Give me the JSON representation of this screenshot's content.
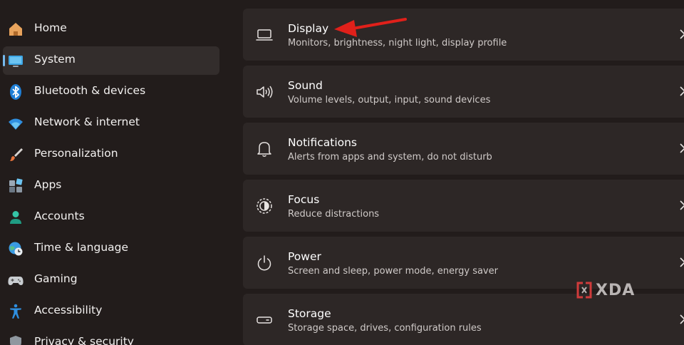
{
  "sidebar": {
    "items": [
      {
        "label": "Home",
        "icon": "home-icon"
      },
      {
        "label": "System",
        "icon": "monitor-icon",
        "active": true
      },
      {
        "label": "Bluetooth & devices",
        "icon": "bluetooth-icon"
      },
      {
        "label": "Network & internet",
        "icon": "wifi-icon"
      },
      {
        "label": "Personalization",
        "icon": "paintbrush-icon"
      },
      {
        "label": "Apps",
        "icon": "apps-icon"
      },
      {
        "label": "Accounts",
        "icon": "person-icon"
      },
      {
        "label": "Time & language",
        "icon": "globe-clock-icon"
      },
      {
        "label": "Gaming",
        "icon": "gamepad-icon"
      },
      {
        "label": "Accessibility",
        "icon": "accessibility-icon"
      },
      {
        "label": "Privacy & security",
        "icon": "shield-icon"
      }
    ]
  },
  "main": {
    "cards": [
      {
        "title": "Display",
        "subtitle": "Monitors, brightness, night light, display profile",
        "icon": "display-icon"
      },
      {
        "title": "Sound",
        "subtitle": "Volume levels, output, input, sound devices",
        "icon": "speaker-icon"
      },
      {
        "title": "Notifications",
        "subtitle": "Alerts from apps and system, do not disturb",
        "icon": "bell-icon"
      },
      {
        "title": "Focus",
        "subtitle": "Reduce distractions",
        "icon": "focus-icon"
      },
      {
        "title": "Power",
        "subtitle": "Screen and sleep, power mode, energy saver",
        "icon": "power-icon"
      },
      {
        "title": "Storage",
        "subtitle": "Storage space, drives, configuration rules",
        "icon": "storage-icon"
      }
    ]
  },
  "watermark": {
    "text": "XDA"
  },
  "colors": {
    "accent": "#76b9ed",
    "arrow": "#e0201a",
    "card_bg": "#2d2726",
    "bg": "#221c1b"
  }
}
